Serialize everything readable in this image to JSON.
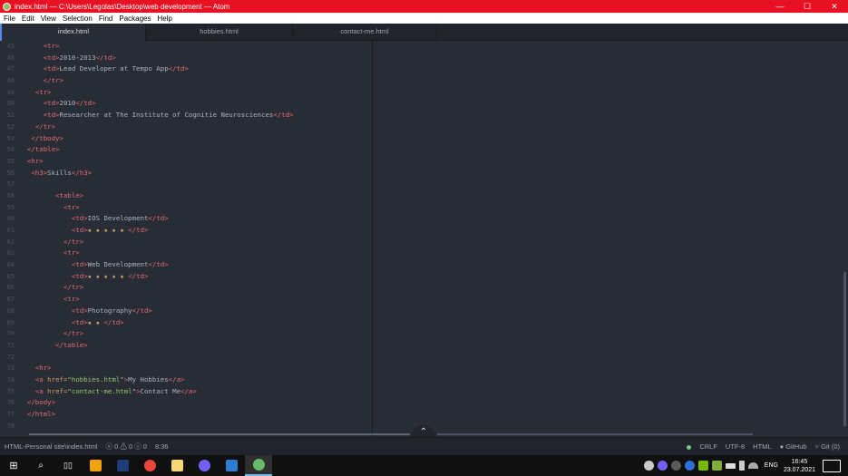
{
  "titlebar": {
    "title": "index.html — C:\\Users\\Legolas\\Desktop\\web development — Atom",
    "minimize": "—",
    "maximize": "☐",
    "close": "✕"
  },
  "menu": [
    "File",
    "Edit",
    "View",
    "Selection",
    "Find",
    "Packages",
    "Help"
  ],
  "tabs": [
    {
      "label": "index.html"
    },
    {
      "label": "hobbies.html"
    },
    {
      "label": "contact-me.html"
    }
  ],
  "line_numbers": [
    "45",
    "46",
    "47",
    "48",
    "49",
    "50",
    "51",
    "52",
    "53",
    "54",
    "55",
    "56",
    "57",
    "58",
    "59",
    "60",
    "61",
    "62",
    "63",
    "64",
    "65",
    "66",
    "67",
    "68",
    "69",
    "70",
    "71",
    "72",
    "73",
    "74",
    "75",
    "76",
    "77",
    "78"
  ],
  "code": {
    "l45": "<tr>",
    "l46_td1": "<td>",
    "l46_text": "2010-2013",
    "l46_td2": "</td>",
    "l47_td1": "<td>",
    "l47_text": "Lead Developer at Tempo App",
    "l47_td2": "</td>",
    "l48": "</tr>",
    "l49": "<tr>",
    "l50_td1": "<td>",
    "l50_text": "2010",
    "l50_td2": "</td>",
    "l51_td1": "<td>",
    "l51_text": "Researcher at The Institute of Cognitie Neurosciences",
    "l51_td2": "</td>",
    "l52": "</tr>",
    "l53": "</tbody>",
    "l54": "</table>",
    "l55": "<hr>",
    "l56_h1": "<h3>",
    "l56_text": "Skills",
    "l56_h2": "</h3>",
    "l58": "<table>",
    "l59": "<tr>",
    "l60_td1": "<td>",
    "l60_text": "IOS Development",
    "l60_td2": "</td>",
    "l61_td1": "<td>",
    "l61_stars": "★ ★ ★ ★ ★",
    "l61_td2": "</td>",
    "l62": "</tr>",
    "l63": "<tr>",
    "l64_td1": "<td>",
    "l64_text": "Web Development",
    "l64_td2": "</td>",
    "l65_td1": "<td>",
    "l65_stars": "★ ★ ★ ★ ★",
    "l65_td2": "</td>",
    "l66": "</tr>",
    "l67": "<tr>",
    "l68_td1": "<td>",
    "l68_text": "Photography",
    "l68_td2": "</td>",
    "l69_td1": "<td>",
    "l69_stars": "★ ★",
    "l69_td2": "</td>",
    "l70": "</tr>",
    "l71": "</table>",
    "l73": "<hr>",
    "l74_open": "<a",
    "l74_attr": "href=",
    "l74_val": "\"hobbies.html\"",
    "l74_close": ">",
    "l74_text": "My Hobbies",
    "l74_end": "</a>",
    "l75_open": "<a",
    "l75_attr": "href=",
    "l75_val": "\"contact-me.html\"",
    "l75_close": ">",
    "l75_text": "Contact Me",
    "l75_end": "</a>",
    "l76": "</body>",
    "l77": "</html>"
  },
  "statusbar": {
    "file": "HTML-Personal site\\index.html",
    "diagnostics": "ⓧ 0 ⚠ 0 ⓘ 0",
    "cursor": "8:36",
    "line_ending": "CRLF",
    "encoding": "UTF-8",
    "grammar": "HTML",
    "github": "GitHub",
    "git": "Git (0)"
  },
  "taskbar": {
    "language": "ENG",
    "time": "16:45",
    "date": "23.07.2021"
  },
  "colors": {
    "titlebar": "#e81123",
    "editor_bg": "#282c34",
    "tag": "#e06c75",
    "attr": "#d19a66",
    "string": "#98c379",
    "star": "#e5c07b"
  }
}
